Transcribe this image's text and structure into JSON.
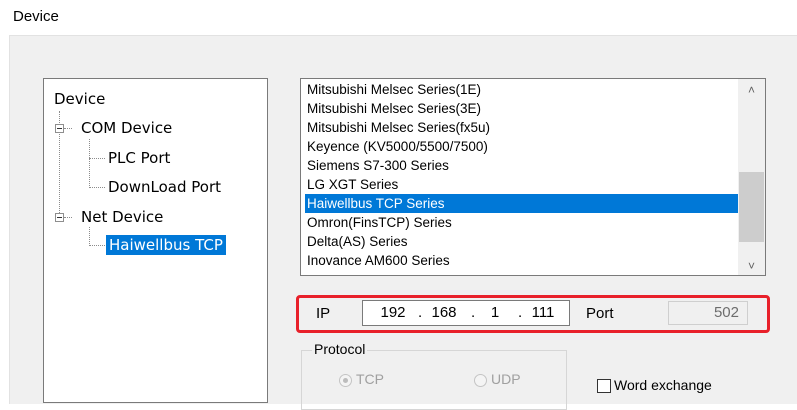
{
  "header": {
    "title": "Device"
  },
  "tree": {
    "root": "Device",
    "com_device": "COM Device",
    "plc_port": "PLC Port",
    "download_port": "DownLoad Port",
    "net_device": "Net Device",
    "haiwellbus_tcp": "Haiwellbus TCP"
  },
  "protocol_list": {
    "items": [
      "Mitsubishi Melsec Series(1E)",
      "Mitsubishi Melsec Series(3E)",
      "Mitsubishi Melsec Series(fx5u)",
      "Keyence (KV5000/5500/7500)",
      "Siemens S7-300 Series",
      "LG XGT Series",
      "Haiwellbus TCP Series",
      "Omron(FinsTCP) Series",
      "Delta(AS) Series",
      "Inovance AM600 Series"
    ],
    "selected": "Haiwellbus TCP Series"
  },
  "network": {
    "ip_label": "IP",
    "ip": [
      "192",
      "168",
      "1",
      "111"
    ],
    "port_label": "Port",
    "port": "502"
  },
  "protocol": {
    "legend": "Protocol",
    "tcp_label": "TCP",
    "udp_label": "UDP",
    "selected": "TCP"
  },
  "options": {
    "word_exchange_label": "Word exchange",
    "word_exchange_checked": false
  },
  "colors": {
    "selection": "#0078d7",
    "highlight_border": "#e8202a"
  }
}
